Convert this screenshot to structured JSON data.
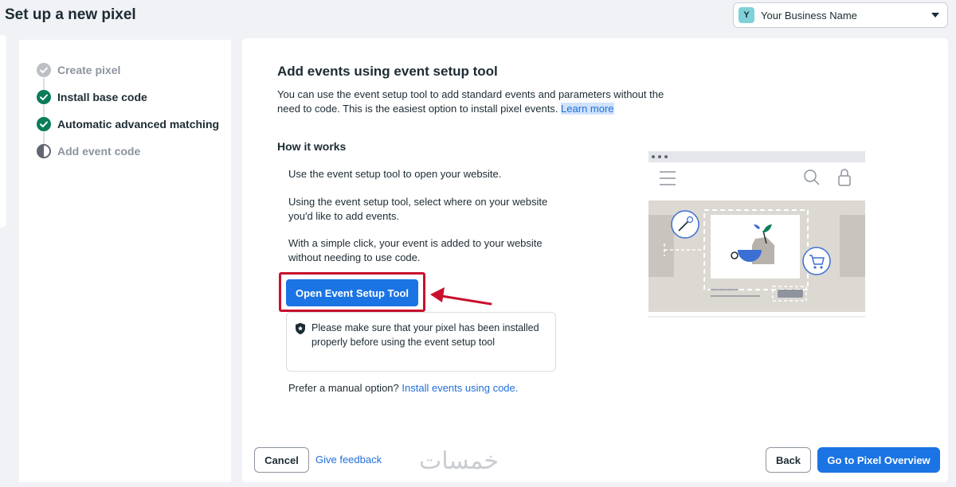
{
  "header": {
    "title": "Set up a new pixel",
    "business": {
      "avatar_letter": "Y",
      "name": "Your Business Name"
    }
  },
  "steps": [
    {
      "label": "Create pixel",
      "state": "done-muted"
    },
    {
      "label": "Install base code",
      "state": "done"
    },
    {
      "label": "Automatic advanced matching",
      "state": "done"
    },
    {
      "label": "Add event code",
      "state": "current-muted"
    }
  ],
  "main": {
    "heading": "Add events using event setup tool",
    "description": "You can use the event setup tool to add standard events and parameters without the need to code. This is the easiest option to install pixel events.",
    "learn_more": "Learn more",
    "how_heading": "How it works",
    "how_steps": [
      "Use the event setup tool to open your website.",
      "Using the event setup tool, select where on your website you'd like to add events.",
      "With a simple click, your event is added to your website without needing to use code."
    ],
    "open_tool_button": "Open Event Setup Tool",
    "notice": "Please make sure that your pixel has been installed properly before using the event setup tool",
    "manual_prefix": "Prefer a manual option?",
    "manual_link": "Install events using code."
  },
  "footer": {
    "cancel": "Cancel",
    "feedback": "Give feedback",
    "back": "Back",
    "overview": "Go to Pixel Overview"
  },
  "watermark": "خمسات",
  "colors": {
    "primary": "#1b74e4",
    "link": "#216fdb",
    "step_done": "#0a7c59",
    "highlight": "#c8102e"
  }
}
